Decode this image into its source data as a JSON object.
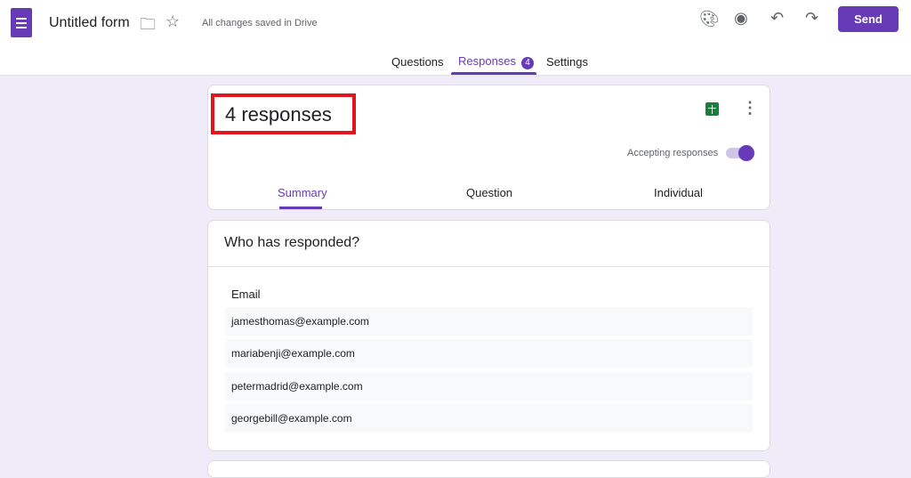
{
  "header": {
    "title": "Untitled form",
    "save_status": "All changes saved in Drive",
    "send_label": "Send"
  },
  "tabs": [
    {
      "label": "Questions"
    },
    {
      "label": "Responses",
      "badge": "4"
    },
    {
      "label": "Settings"
    }
  ],
  "responses": {
    "count_label": "4 responses",
    "accepting_label": "Accepting responses",
    "accepting": true,
    "subtabs": [
      "Summary",
      "Question",
      "Individual"
    ]
  },
  "who": {
    "title": "Who has responded?",
    "column": "Email",
    "emails": [
      "jamesthomas@example.com",
      "mariabenji@example.com",
      "petermadrid@example.com",
      "georgebill@example.com"
    ]
  },
  "colors": {
    "accent": "#673ab7",
    "highlight": "#e3141b"
  }
}
